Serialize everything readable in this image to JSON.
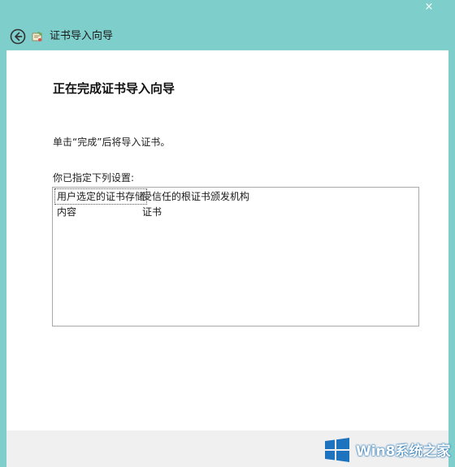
{
  "window": {
    "close_glyph": "×"
  },
  "header": {
    "title": "证书导入向导",
    "back_icon": "back-arrow-icon",
    "wizard_icon": "certificate-wizard-icon"
  },
  "main": {
    "heading": "正在完成证书导入向导",
    "instruction": "单击“完成”后将导入证书。",
    "summary_label": "你已指定下列设置:",
    "settings": [
      {
        "key": "用户选定的证书存储",
        "value": "受信任的根证书颁发机构"
      },
      {
        "key": "内容",
        "value": "证书"
      }
    ]
  },
  "watermark": {
    "text": "Win8系统之家",
    "logo_color": "#1e73be"
  },
  "colors": {
    "accent": "#7ecfcc",
    "content_bg": "#ffffff",
    "footer_bg": "#f0f0f0"
  }
}
